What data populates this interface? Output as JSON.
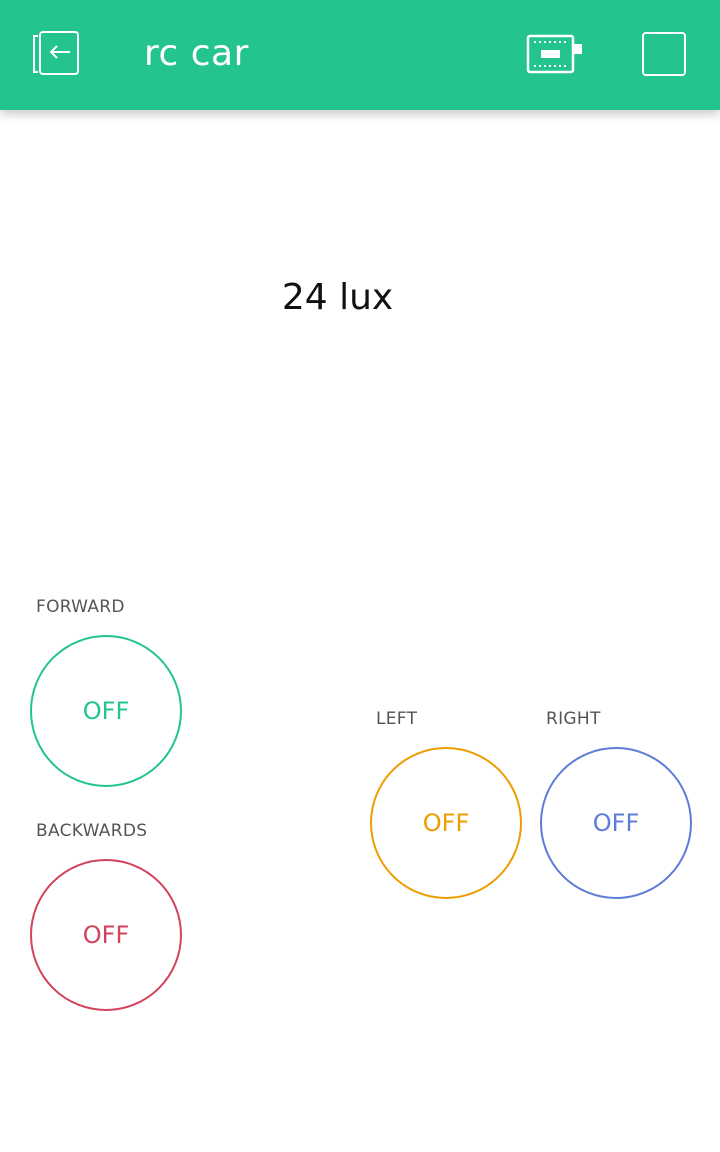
{
  "header": {
    "title": "rc car",
    "bg_color": "#23c48e",
    "icons": [
      "exit-icon",
      "device-icon",
      "stop-icon"
    ]
  },
  "display": {
    "value": "24 lux"
  },
  "buttons": {
    "forward": {
      "label": "FORWARD",
      "state": "OFF",
      "color": "#23c48e"
    },
    "backwards": {
      "label": "BACKWARDS",
      "state": "OFF",
      "color": "#d3435c"
    },
    "left": {
      "label": "LEFT",
      "state": "OFF",
      "color": "#ed9d00"
    },
    "right": {
      "label": "RIGHT",
      "state": "OFF",
      "color": "#5f7cd8"
    }
  }
}
